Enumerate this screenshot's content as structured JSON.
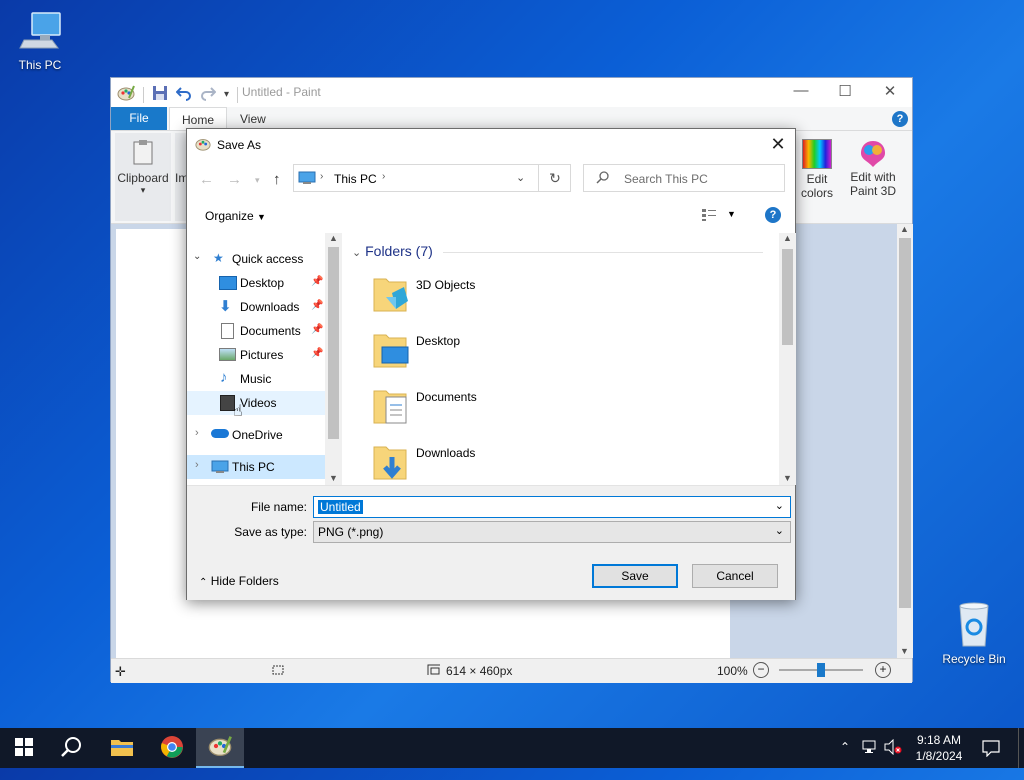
{
  "desktop": {
    "icons": [
      {
        "label": "This PC",
        "icon": "computer-icon"
      },
      {
        "label": "Recycle Bin",
        "icon": "recycle-bin-icon"
      }
    ]
  },
  "paint": {
    "title": "Untitled - Paint",
    "tabs": {
      "file": "File",
      "home": "Home",
      "view": "View"
    },
    "help": "?",
    "ribbon": {
      "clipboard": "Clipboard",
      "image_partial": "Im",
      "edit_colors_line1": "Edit",
      "edit_colors_line2": "colors",
      "edit_paint3d_line1": "Edit with",
      "edit_paint3d_line2": "Paint 3D"
    },
    "status": {
      "dimensions": "614 × 460px",
      "zoom": "100%",
      "zoom_level": 0.5
    }
  },
  "dialog": {
    "title": "Save As",
    "address": {
      "location": "This PC"
    },
    "search": {
      "placeholder": "Search This PC"
    },
    "toolbar": {
      "organize": "Organize"
    },
    "help": "?",
    "nav": {
      "quick_access": "Quick access",
      "items": [
        "Desktop",
        "Downloads",
        "Documents",
        "Pictures",
        "Music",
        "Videos"
      ],
      "onedrive": "OneDrive",
      "this_pc": "This PC"
    },
    "folders_header": "Folders (7)",
    "folders": [
      "3D Objects",
      "Desktop",
      "Documents",
      "Downloads"
    ],
    "file_name_label": "File name:",
    "file_name_value": "Untitled",
    "save_type_label": "Save as type:",
    "save_type_value": "PNG (*.png)",
    "hide_folders": "Hide Folders",
    "save_button": "Save",
    "cancel_button": "Cancel"
  },
  "taskbar": {
    "time": "9:18 AM",
    "date": "1/8/2024"
  }
}
